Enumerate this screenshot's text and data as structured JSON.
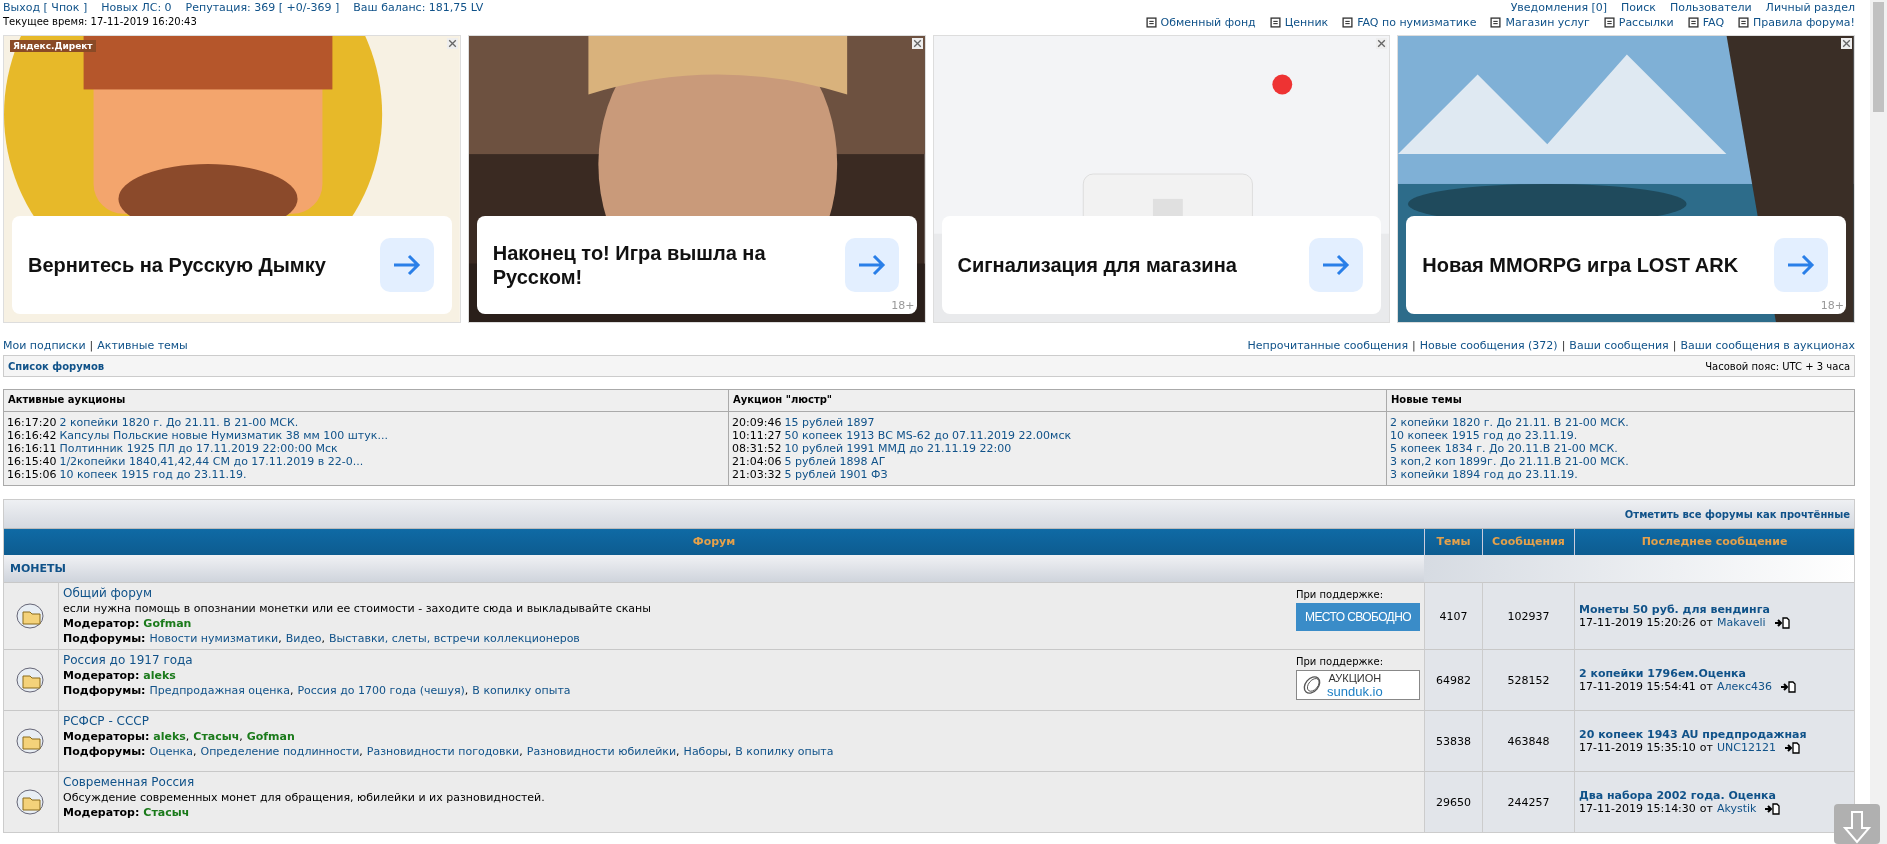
{
  "top_bar": {
    "left": [
      "Выход [ Чпок ]",
      "Новых ЛС: 0",
      "Репутация: 369 [ +0/-369 ]",
      "Ваш баланс: 181,75 LV"
    ],
    "right": [
      "Уведомления [0]",
      "Поиск",
      "Пользователи",
      "Личный раздел"
    ],
    "time": "Текущее время: 17-11-2019 16:20:43",
    "links": [
      "Обменный фонд",
      "Ценник",
      "FAQ по нумизматике",
      "Магазин услуг",
      "Рассылки",
      "FAQ",
      "Правила форума!"
    ]
  },
  "ads": {
    "source": "Яндекс.Директ",
    "items": [
      {
        "text": "Вернитесь на Русскую Дымку"
      },
      {
        "text": "Наконец то! Игра вышла на Русском!",
        "age": "18+"
      },
      {
        "text": "Сигнализация для магазина"
      },
      {
        "text": "Новая MMORPG игра LOST ARK",
        "age": "18+"
      }
    ]
  },
  "separators": {
    "nav": "|",
    "list": ","
  },
  "nav_left": [
    "Мои подписки",
    "Активные темы"
  ],
  "nav_right": [
    "Непрочитанные сообщения",
    "Новые сообщения (372)",
    "Ваши сообщения",
    "Ваши сообщения в аукционах"
  ],
  "forum_list_bar": {
    "title": "Список форумов",
    "timezone": "Часовой пояс: UTC + 3 часа"
  },
  "auctions": [
    {
      "title": "Активные аукционы",
      "rows": [
        {
          "time": "16:17:20",
          "text": "2 копейки 1820 г. До 21.11. В 21-00 МСК."
        },
        {
          "time": "16:16:42",
          "text": "Капсулы Польские новые Нумизматик 38 мм 100 штук..."
        },
        {
          "time": "16:16:11",
          "text": "Полтинник 1925 ПЛ до 17.11.2019 22:00:00 Мск"
        },
        {
          "time": "16:15:40",
          "text": "1/2копейки 1840,41,42,44 СМ до 17.11.2019 в 22-0..."
        },
        {
          "time": "16:15:06",
          "text": "10 копеек 1915 год до 23.11.19."
        }
      ]
    },
    {
      "title": "Аукцион \"люстр\"",
      "rows": [
        {
          "time": "20:09:46",
          "text": "15 рублей 1897"
        },
        {
          "time": "10:11:27",
          "text": "50 копеек 1913 ВС MS-62 до 07.11.2019 22.00мск"
        },
        {
          "time": "08:31:52",
          "text": "10 рублей 1991 ММД до 21.11.19 22:00"
        },
        {
          "time": "21:04:06",
          "text": "5 рублей 1898 АГ"
        },
        {
          "time": "21:03:32",
          "text": "5 рублей 1901 ФЗ"
        }
      ]
    },
    {
      "title": "Новые темы",
      "rows": [
        {
          "text": "2 копейки 1820 г. До 21.11. В 21-00 МСК."
        },
        {
          "text": "10 копеек 1915 год до 23.11.19."
        },
        {
          "text": "5 копеек 1834 г. До 20.11.В 21-00 МСК."
        },
        {
          "text": "3 коп,2 коп 1899г. До 21.11.В 21-00 МСК."
        },
        {
          "text": "3 копейки 1894 год до 23.11.19."
        }
      ]
    }
  ],
  "forum_table": {
    "mark_all_read": "Отметить все форумы как прочтённые",
    "columns": [
      "Форум",
      "Темы",
      "Сообщения",
      "Последнее сообщение"
    ],
    "category": "МОНЕТЫ",
    "rows": [
      {
        "title": "Общий форум",
        "description": "если нужна помощь в опознании монетки или ее стоимости - заходите сюда и выкладывайте сканы",
        "moderator_label": "Модератор:",
        "moderators": [
          "Gofman"
        ],
        "subforum_label": "Подфорумы:",
        "subforums": [
          "Новости нумизматики",
          "Видео",
          "Выставки, слеты, встречи коллекционеров"
        ],
        "sponsor": {
          "label": "При поддержке:",
          "kind": "free",
          "lines": [
            "МЕСТО СВОБОДНО"
          ]
        },
        "topics": "4107",
        "posts": "102937",
        "last": {
          "title": "Монеты 50 руб. для вендинга",
          "date": "17-11-2019 15:20:26",
          "by": "от",
          "author": "Makaveli"
        }
      },
      {
        "title": "Россия до 1917 года",
        "moderator_label": "Модератор:",
        "moderators": [
          "aleks"
        ],
        "subforum_label": "Подфорумы:",
        "subforums": [
          "Предпродажная оценка",
          "Россия до 1700 года (чешуя)",
          "В копилку опыта"
        ],
        "sponsor": {
          "label": "При поддержке:",
          "kind": "sunduk",
          "lines": [
            "АУКЦИОН",
            "sunduk.io"
          ]
        },
        "topics": "64982",
        "posts": "528152",
        "last": {
          "title": "2 копейки 1796ем.Оценка",
          "date": "17-11-2019 15:54:41",
          "by": "от",
          "author": "Алекс436"
        }
      },
      {
        "title": "РСФСР - СССР",
        "moderator_label": "Модераторы:",
        "moderators": [
          "aleks",
          "Стасыч",
          "Gofman"
        ],
        "subforum_label": "Подфорумы:",
        "subforums": [
          "Оценка",
          "Определение подлинности",
          "Разновидности погодовки",
          "Разновидности юбилейки",
          "Наборы",
          "В копилку опыта"
        ],
        "topics": "53838",
        "posts": "463848",
        "last": {
          "title": "20 копеек 1943 AU предпродажная",
          "date": "17-11-2019 15:35:10",
          "by": "от",
          "author": "UNC12121"
        }
      },
      {
        "title": "Современная Россия",
        "description": "Обсуждение современных монет для обращения, юбилейки и их разновидностей.",
        "moderator_label": "Модератор:",
        "moderators": [
          "Стасыч"
        ],
        "topics": "29650",
        "posts": "244257",
        "last": {
          "title": "Два набора 2002 года. Оценка",
          "date": "17-11-2019 15:14:30",
          "by": "от",
          "author": "Akystik"
        }
      }
    ]
  }
}
